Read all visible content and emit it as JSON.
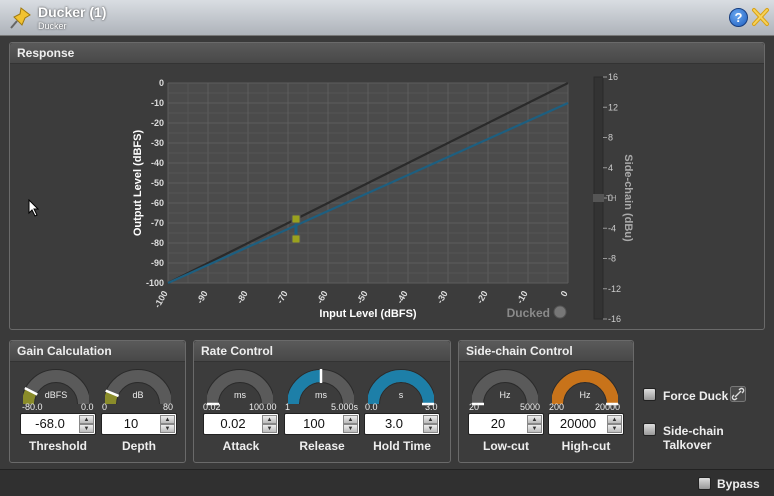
{
  "window": {
    "title": "Ducker (1)",
    "subtitle": "Ducker",
    "help_icon": "help-icon",
    "close_icon": "close-icon",
    "app_icon": "pushpin-icon",
    "help_glyph": "?"
  },
  "response": {
    "header": "Response",
    "chart_data": {
      "type": "line",
      "xlabel": "Input Level (dBFS)",
      "ylabel": "Output Level (dBFS)",
      "xlim": [
        -100,
        0
      ],
      "ylim": [
        -100,
        0
      ],
      "x_ticks": [
        "-100",
        "-90",
        "-80",
        "-70",
        "-60",
        "-50",
        "-40",
        "-30",
        "-20",
        "-10",
        "0"
      ],
      "y_ticks": [
        "0",
        "-10",
        "-20",
        "-30",
        "-40",
        "-50",
        "-60",
        "-70",
        "-80",
        "-90",
        "-100"
      ],
      "grid": true,
      "series": [
        {
          "x": [
            -100,
            0
          ],
          "y": [
            -100,
            0
          ],
          "color": "#2a2a2a"
        },
        {
          "x": [
            -100,
            0
          ],
          "y": [
            -100,
            -10
          ],
          "color": "#1d5f80"
        }
      ],
      "threshold_marker": {
        "x": -68,
        "y_top": -68,
        "y_bottom": -78,
        "color": "#9aa21e"
      },
      "ducked_label": "Ducked",
      "sidechain": {
        "label": "Side-chain (dBu)",
        "ticks": [
          "16",
          "12",
          "8",
          "4",
          "0",
          "-4",
          "-8",
          "-12",
          "-16"
        ],
        "th_label": "TH",
        "range": [
          -16,
          16
        ]
      }
    }
  },
  "gain": {
    "header": "Gain Calculation",
    "threshold": {
      "unit": "dBFS",
      "min": "-80.0",
      "max": "0.0",
      "value": "-68.0",
      "name": "Threshold",
      "fraction": 0.15,
      "color": "#8a8c2a"
    },
    "depth": {
      "unit": "dB",
      "min": "0",
      "max": "80",
      "value": "10",
      "name": "Depth",
      "fraction": 0.125,
      "color": "#8a8c2a"
    }
  },
  "rate": {
    "header": "Rate Control",
    "attack": {
      "unit": "ms",
      "min": "0.02",
      "max": "100.00",
      "value": "0.02",
      "name": "Attack",
      "fraction": 0.0,
      "color": "#555"
    },
    "release": {
      "unit": "ms",
      "min": "1",
      "max": "5.000s",
      "value": "100",
      "name": "Release",
      "fraction": 0.5,
      "color": "#1d7fa8"
    },
    "hold": {
      "unit": "s",
      "min": "0.0",
      "max": "3.0",
      "value": "3.0",
      "name": "Hold Time",
      "fraction": 1.0,
      "color": "#1d7fa8"
    }
  },
  "sidechain": {
    "header": "Side-chain Control",
    "lowcut": {
      "unit": "Hz",
      "min": "20",
      "max": "5000",
      "value": "20",
      "name": "Low-cut",
      "fraction": 0.0,
      "color": "#555"
    },
    "highcut": {
      "unit": "Hz",
      "min": "200",
      "max": "20000",
      "value": "20000",
      "name": "High-cut",
      "fraction": 1.0,
      "color": "#c8731a"
    }
  },
  "options": {
    "force_duck": "Force Duck",
    "talkover": "Side-chain Talkover",
    "link_icon": "link-icon"
  },
  "status": {
    "bypass": "Bypass"
  }
}
